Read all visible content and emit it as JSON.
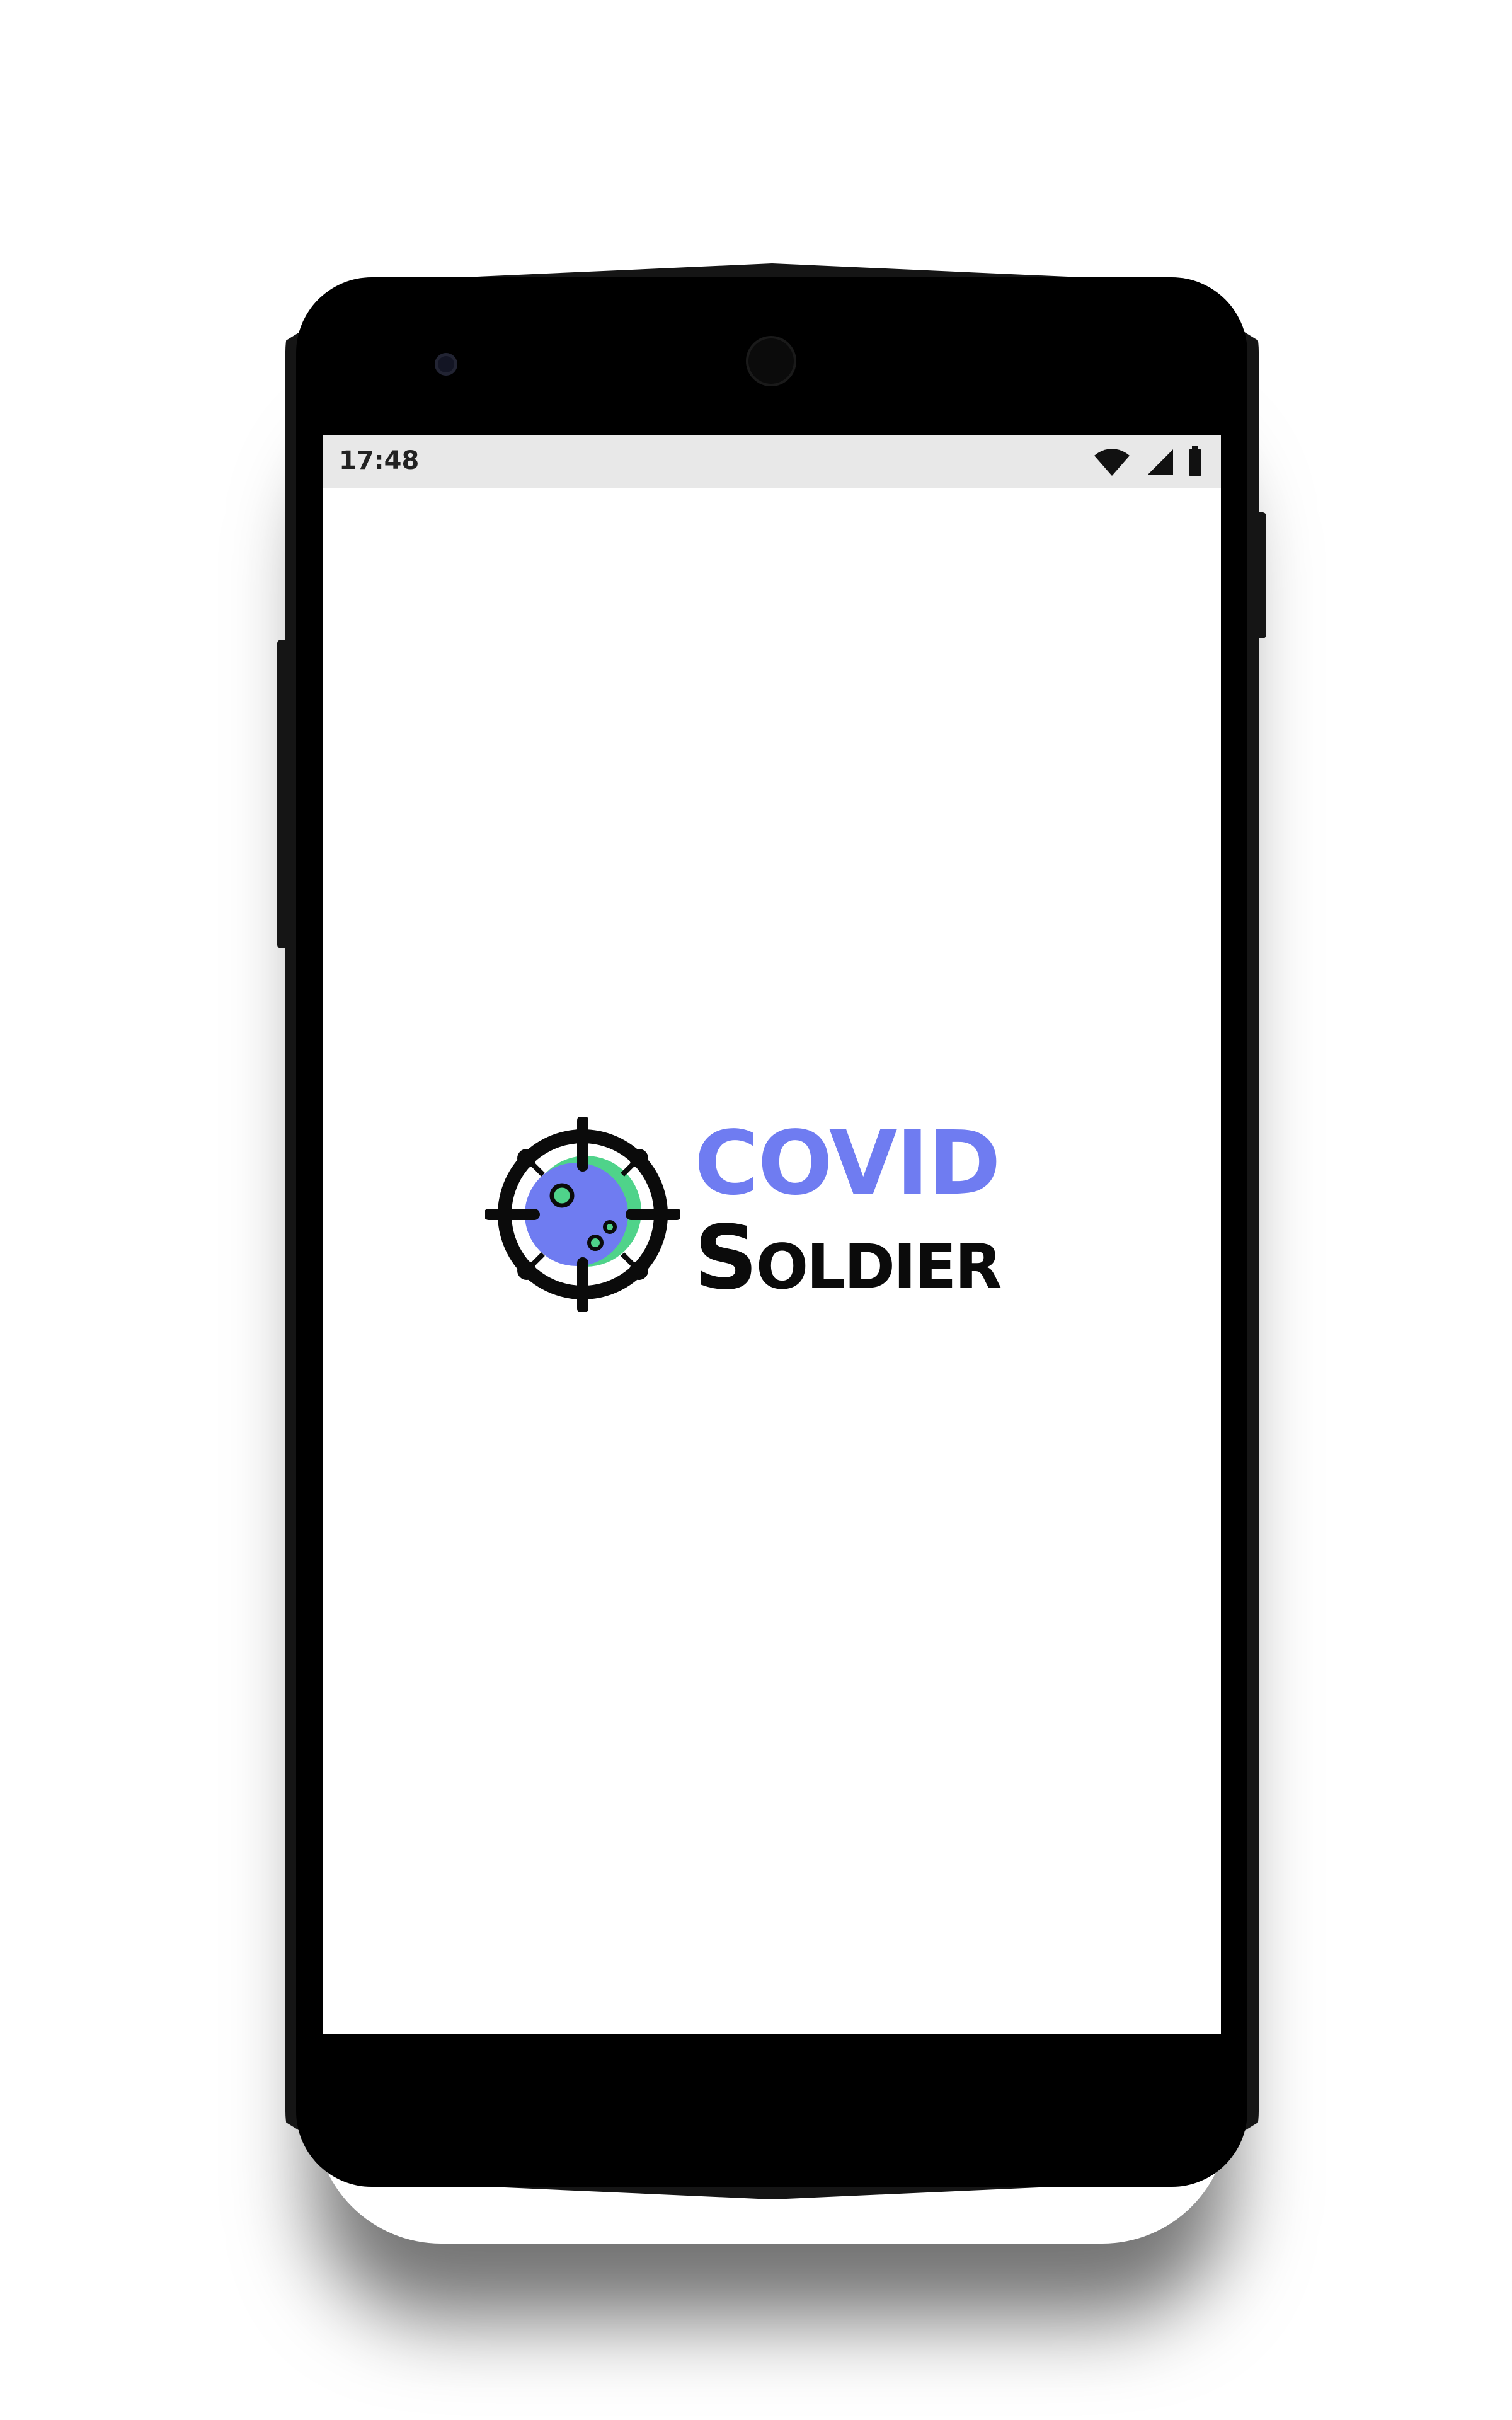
{
  "status_bar": {
    "time": "17:48",
    "icons": [
      "wifi-icon",
      "cellular-signal-icon",
      "battery-icon"
    ]
  },
  "splash": {
    "logo_icon": "virus-crosshair-icon",
    "brand_line_1": "COVID",
    "brand_line_2": "Soldier"
  },
  "colors": {
    "brand_blue": "#6f7cf1",
    "brand_green": "#4fd38a",
    "brand_black": "#0b0b0b",
    "status_bar_bg": "#e8e8e8",
    "device_body": "#151515"
  }
}
